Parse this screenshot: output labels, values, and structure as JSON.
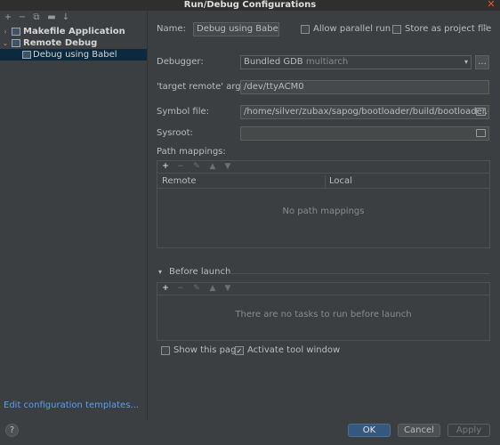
{
  "window": {
    "title": "Run/Debug Configurations"
  },
  "tree_toolbar": {
    "icons": [
      "add-icon",
      "remove-icon",
      "copy-icon",
      "folder-icon",
      "sort-icon"
    ],
    "glyphs": [
      "+",
      "−",
      "⧉",
      "▬",
      "↓"
    ]
  },
  "tree": {
    "items": [
      {
        "label": "Makefile Application",
        "bold": true,
        "arrow": "›",
        "level": 0
      },
      {
        "label": "Remote Debug",
        "bold": true,
        "arrow": "⌄",
        "level": 0
      },
      {
        "label": "Debug using Babel",
        "bold": false,
        "arrow": "",
        "level": 1,
        "selected": true
      }
    ]
  },
  "edit_templates_link": "Edit configuration templates...",
  "form": {
    "name_label": "Name:",
    "name_value": "Debug using Babel",
    "allow_parallel_label": "Allow parallel run",
    "store_project_label": "Store as project file",
    "debugger_label": "Debugger:",
    "debugger_value": "Bundled GDB",
    "debugger_suffix": "multiarch",
    "more_button": "...",
    "target_remote_label": "'target remote' args:",
    "target_remote_value": "/dev/ttyACM0",
    "symbol_file_label": "Symbol file:",
    "symbol_file_value": "/home/silver/zubax/sapog/bootloader/build/bootloader.elf",
    "sysroot_label": "Sysroot:",
    "sysroot_value": "",
    "path_mappings_label": "Path mappings:",
    "path_mappings_columns": [
      "Remote",
      "Local"
    ],
    "path_mappings_empty": "No path mappings",
    "before_launch_label": "Before launch",
    "before_launch_empty": "There are no tasks to run before launch",
    "show_page_label": "Show this page",
    "activate_tool_label": "Activate tool window",
    "activate_tool_checked": true,
    "show_page_checked": false
  },
  "list_toolbar": {
    "glyphs": [
      "+",
      "−",
      "✎",
      "▲",
      "▼"
    ]
  },
  "buttons": {
    "help": "?",
    "ok": "OK",
    "cancel": "Cancel",
    "apply": "Apply"
  }
}
